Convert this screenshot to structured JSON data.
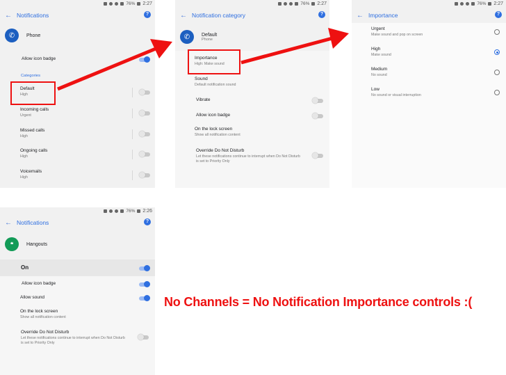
{
  "status": {
    "time_a": "2:27",
    "time_b": "2:26",
    "battery": "76%"
  },
  "panel1": {
    "title": "Notifications",
    "app_name": "Phone",
    "allow_icon_badge": "Allow icon badge",
    "section": "Categories",
    "items": [
      {
        "label": "Default",
        "sub": "High"
      },
      {
        "label": "Incoming calls",
        "sub": "Urgent"
      },
      {
        "label": "Missed calls",
        "sub": "High"
      },
      {
        "label": "Ongoing calls",
        "sub": "High"
      },
      {
        "label": "Voicemails",
        "sub": "High"
      }
    ]
  },
  "panel2": {
    "title": "Notification category",
    "category": "Default",
    "app_name": "Phone",
    "importance_label": "Importance",
    "importance_value": "High: Make sound",
    "sound_label": "Sound",
    "sound_value": "Default notification sound",
    "vibrate": "Vibrate",
    "allow_icon_badge": "Allow icon badge",
    "lock_label": "On the lock screen",
    "lock_value": "Show all notification content",
    "dnd_label": "Override Do Not Disturb",
    "dnd_desc": "Let these notifications continue to interrupt when Do Not Disturb is set to Priority Only"
  },
  "panel3": {
    "title": "Importance",
    "options": [
      {
        "label": "Urgent",
        "sub": "Make sound and pop on screen",
        "selected": false
      },
      {
        "label": "High",
        "sub": "Make sound",
        "selected": true
      },
      {
        "label": "Medium",
        "sub": "No sound",
        "selected": false
      },
      {
        "label": "Low",
        "sub": "No sound or visual interruption",
        "selected": false
      }
    ]
  },
  "panel4": {
    "title": "Notifications",
    "app_name": "Hangouts",
    "on_label": "On",
    "allow_icon_badge": "Allow icon badge",
    "allow_sound": "Allow sound",
    "lock_label": "On the lock screen",
    "lock_value": "Show all notification content",
    "dnd_label": "Override Do Not Disturb",
    "dnd_desc": "Let these notifications continue to interrupt when Do Not Disturb is set to Priority Only"
  },
  "caption": "No Channels = No Notification Importance controls :(",
  "colors": {
    "accent": "#2f6fe0",
    "annotation": "#ee1111"
  }
}
